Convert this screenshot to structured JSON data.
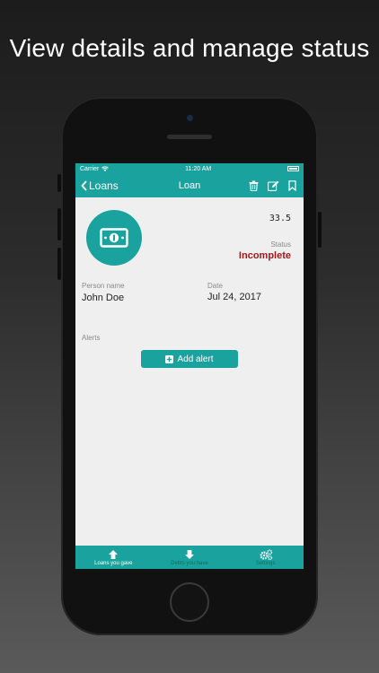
{
  "headline": "View details and manage status",
  "status_bar": {
    "carrier": "Carrier",
    "time": "11:20 AM"
  },
  "nav": {
    "back_label": "Loans",
    "title": "Loan"
  },
  "loan": {
    "amount": "33.5",
    "status_label": "Status",
    "status_value": "Incomplete",
    "person_label": "Person name",
    "person_value": "John Doe",
    "date_label": "Date",
    "date_value": "Jul 24, 2017"
  },
  "alerts": {
    "label": "Alerts",
    "add_button": "Add alert"
  },
  "tabs": [
    {
      "label": "Loans you gave",
      "icon": "arrow-up-icon",
      "active": true
    },
    {
      "label": "Debts you have",
      "icon": "arrow-down-icon",
      "active": false
    },
    {
      "label": "Settings",
      "icon": "gears-icon",
      "active": false
    }
  ],
  "colors": {
    "accent": "#1aa39e",
    "status_incomplete": "#a01818",
    "screen_bg": "#efefef"
  }
}
